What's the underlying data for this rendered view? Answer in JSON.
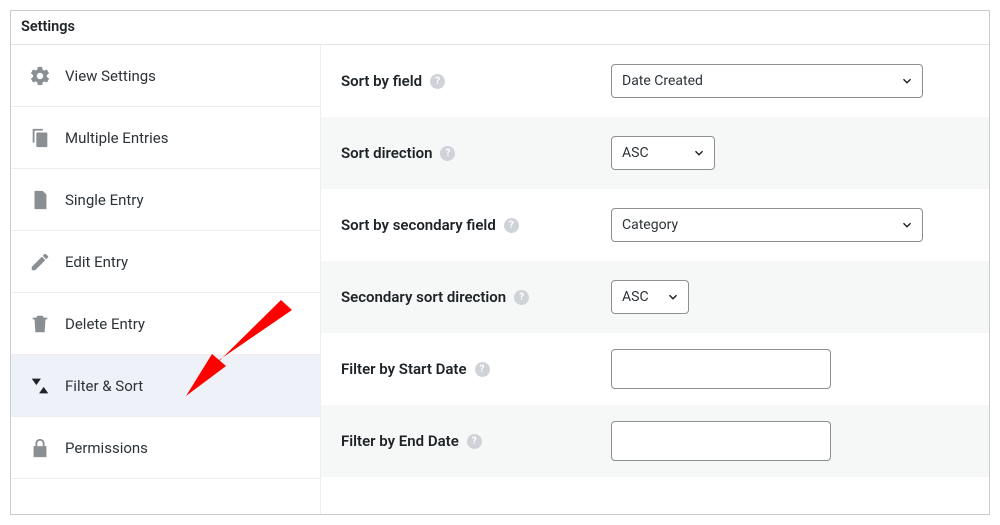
{
  "panel": {
    "title": "Settings"
  },
  "sidebar": {
    "items": [
      {
        "label": "View Settings"
      },
      {
        "label": "Multiple Entries"
      },
      {
        "label": "Single Entry"
      },
      {
        "label": "Edit Entry"
      },
      {
        "label": "Delete Entry"
      },
      {
        "label": "Filter & Sort"
      },
      {
        "label": "Permissions"
      }
    ]
  },
  "fields": {
    "sort_by_field": {
      "label": "Sort by field",
      "value": "Date Created"
    },
    "sort_direction": {
      "label": "Sort direction",
      "value": "ASC"
    },
    "sort_by_secondary": {
      "label": "Sort by secondary field",
      "value": "Category"
    },
    "secondary_direction": {
      "label": "Secondary sort direction",
      "value": "ASC"
    },
    "filter_start": {
      "label": "Filter by Start Date",
      "value": ""
    },
    "filter_end": {
      "label": "Filter by End Date",
      "value": ""
    }
  }
}
